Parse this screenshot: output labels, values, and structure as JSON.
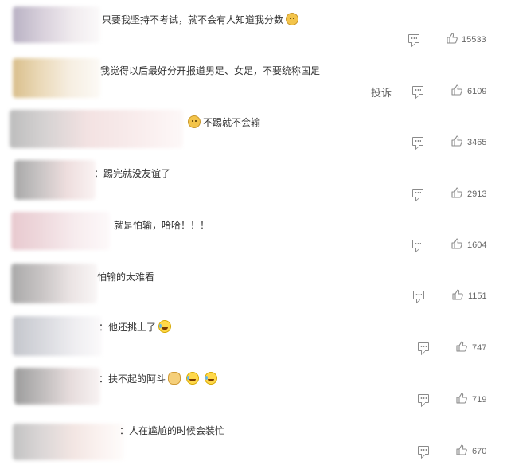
{
  "report_label": "投诉",
  "comments": [
    {
      "text": "只要我坚持不考试，就不会有人知道我分数",
      "emoji": [
        "doge"
      ],
      "emoji_pos": "after",
      "likes": "15533"
    },
    {
      "text": "我觉得以后最好分开报道男足、女足，不要统称国足",
      "emoji": [],
      "likes": "6109"
    },
    {
      "text": "不踢就不会输",
      "emoji": [
        "doge"
      ],
      "emoji_pos": "before",
      "likes": "3465"
    },
    {
      "text": "：踢完就没友谊了",
      "emoji": [],
      "likes": "2913"
    },
    {
      "text": "就是怕输，哈哈！！！",
      "emoji": [],
      "likes": "1604"
    },
    {
      "text": "怕输的太难看",
      "emoji": [],
      "likes": "1151"
    },
    {
      "text": "：他还挑上了",
      "emoji": [
        "laugh-cry"
      ],
      "likes": "747"
    },
    {
      "text": "：扶不起的阿斗",
      "emoji": [
        "fist",
        "laugh-cry",
        "laugh-cry"
      ],
      "likes": "719"
    },
    {
      "text": "：人在尴尬的时候会装忙",
      "emoji": [],
      "likes": "670"
    }
  ],
  "colors": {
    "text": "#333333",
    "icon": "#8a8a8a",
    "count": "#666666"
  },
  "icons": {
    "reply": "comment-icon",
    "like": "thumbs-up-icon"
  }
}
